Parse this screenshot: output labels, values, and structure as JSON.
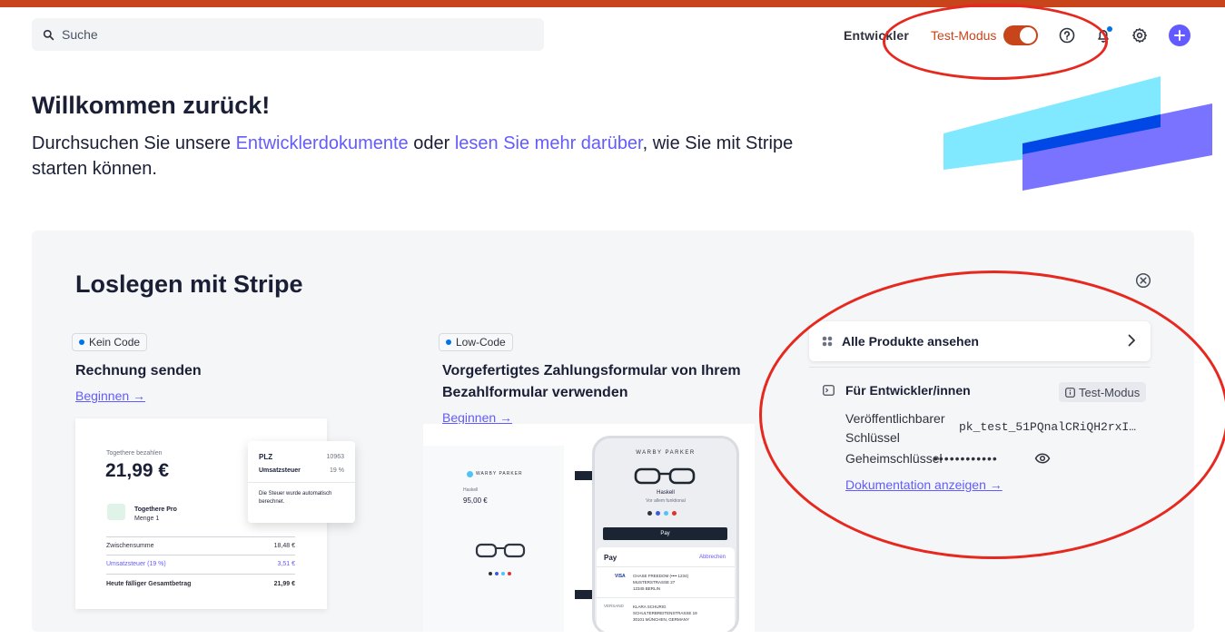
{
  "header": {
    "search_placeholder": "Suche",
    "developer_label": "Entwickler",
    "test_mode_label": "Test-Modus",
    "test_mode_on": true
  },
  "welcome": {
    "title": "Willkommen zurück!",
    "text_1": "Durchsuchen Sie unsere ",
    "link_docs": "Entwicklerdokumente",
    "text_2": " oder ",
    "link_more": "lesen Sie mehr darüber",
    "text_3": ", wie Sie mit Stripe starten können."
  },
  "panel": {
    "title": "Loslegen mit Stripe",
    "cards": [
      {
        "tag": "Kein Code",
        "title": "Rechnung senden",
        "link": "Beginnen →",
        "preview": {
          "pay_label": "Togethere bezahlen",
          "amount": "21,99 €",
          "product": "Togethere Pro",
          "quantity": "Menge 1",
          "subtotal_label": "Zwischensumme",
          "subtotal": "18,48 €",
          "tax_label": "Umsatzsteuer (19 %)",
          "tax": "3,51 €",
          "total_label": "Heute fälliger Gesamtbetrag",
          "total": "21,99 €",
          "popup_zip_label": "PLZ",
          "popup_zip": "10963",
          "popup_tax_label": "Umsatzsteuer",
          "popup_tax": "19 %",
          "popup_note": "Die Steuer wurde automatisch berechnet."
        }
      },
      {
        "tag": "Low-Code",
        "title": "Vorgefertigtes Zahlungsformular von Ihrem Bezahlformular verwenden",
        "link": "Beginnen →",
        "preview": {
          "brand": "WARBY PARKER",
          "product": "Haskell",
          "price": "95,00 €",
          "subtitle": "Vor allem funktional",
          "pay_button": "Pay",
          "apple_pay": "Pay",
          "cancel": "Abbrechen",
          "card_label": "VISA",
          "card_line1": "CHASE FREEDOM (•••• 1234)",
          "card_line2": "MUSTERSTRASSE 27",
          "card_line3": "12345 BERLIN",
          "ship_label": "VERSAND",
          "ship_line1": "KLARA SCHURIG",
          "ship_line2": "SCHULTERBREITENSTRASSE 19",
          "ship_line3": "30101 MÜNCHEN, GERMANY"
        }
      }
    ],
    "all_products": "Alle Produkte ansehen",
    "developers": {
      "title": "Für Entwickler/innen",
      "badge": "Test-Modus",
      "publishable_label": "Veröffentlichbarer Schlüssel",
      "publishable_value": "pk_test_51PQnalCRiQH2rxI…",
      "secret_label": "Geheimschlüssel",
      "secret_value": "••••••••••••",
      "docs_link": "Dokumentation anzeigen →"
    }
  },
  "colors": {
    "accent": "#635bff",
    "test_mode": "#c8441a",
    "annotation": "#e6281f"
  }
}
